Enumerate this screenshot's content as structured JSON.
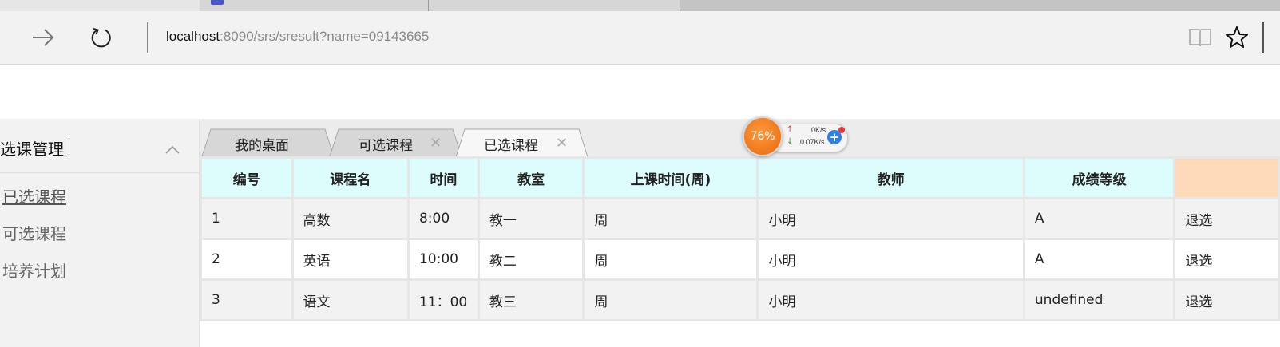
{
  "browser": {
    "url_host": "localhost",
    "url_rest": ":8090/srs/sresult?name=09143665"
  },
  "sidebar": {
    "title": "选课管理",
    "items": [
      {
        "label": "已选课程",
        "active": true
      },
      {
        "label": "可选课程",
        "active": false
      },
      {
        "label": "培养计划",
        "active": false
      }
    ]
  },
  "tabs": [
    {
      "label": "我的桌面",
      "closable": false,
      "active": false
    },
    {
      "label": "可选课程",
      "closable": true,
      "active": false
    },
    {
      "label": "已选课程",
      "closable": true,
      "active": true
    }
  ],
  "speed_widget": {
    "percent": "76%",
    "upload": "0K/s",
    "download": "0.07K/s"
  },
  "table": {
    "headers": [
      "编号",
      "课程名",
      "时间",
      "教室",
      "上课时间(周)",
      "教师",
      "成绩等级",
      ""
    ],
    "rows": [
      [
        "1",
        "高数",
        "8:00",
        "教一",
        "周",
        "小明",
        "A",
        "退选"
      ],
      [
        "2",
        "英语",
        "10:00",
        "教二",
        "周",
        "小明",
        "A",
        "退选"
      ],
      [
        "3",
        "语文",
        "11：00",
        "教三",
        "周",
        "小明",
        "undefined",
        "退选"
      ]
    ]
  },
  "colors": {
    "header_bg": "#ddfdfd",
    "action_header_bg": "#ffdab9",
    "speed_ball": "#e8670a"
  }
}
